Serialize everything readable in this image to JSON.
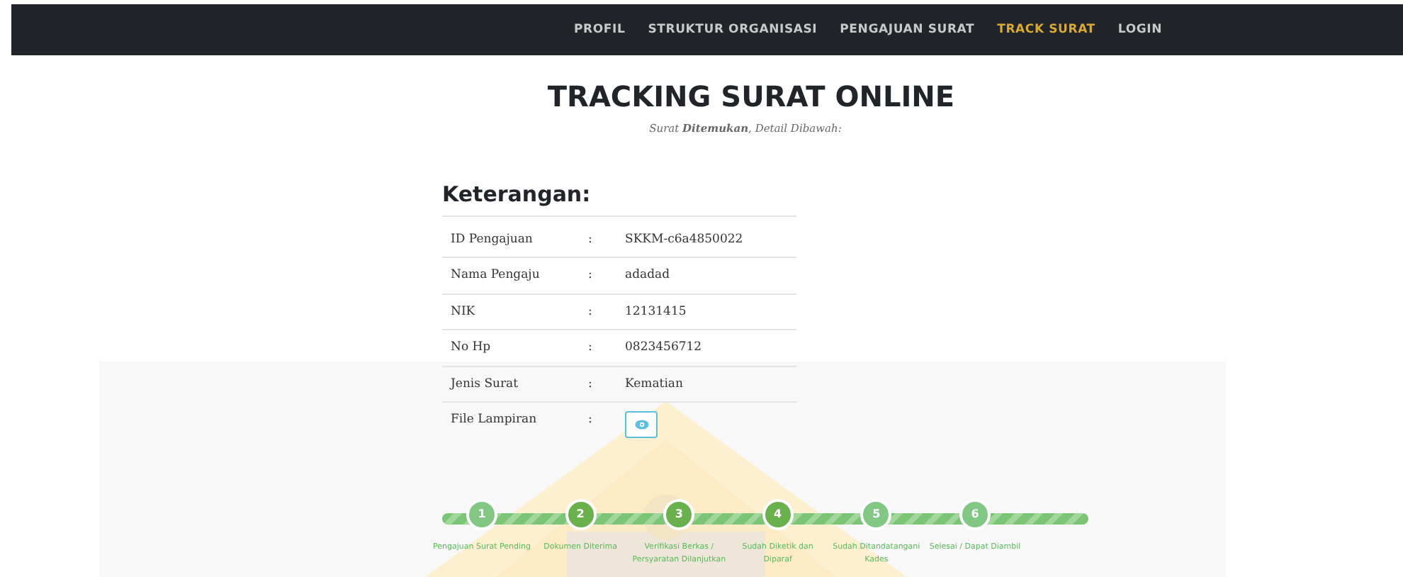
{
  "navbar": {
    "items": [
      {
        "label": "PROFIL",
        "selected": false
      },
      {
        "label": "STRUKTUR ORGANISASI",
        "selected": false
      },
      {
        "label": "PENGAJUAN SURAT",
        "selected": false
      },
      {
        "label": "TRACK SURAT",
        "selected": true
      },
      {
        "label": "LOGIN",
        "selected": false
      }
    ]
  },
  "header": {
    "title": "TRACKING SURAT ONLINE",
    "subtitle": "Surat **Ditemukan**, Detail Dibawah:"
  },
  "details": {
    "heading": "Keterangan:",
    "rows": [
      {
        "label": "ID Pengajuan",
        "separator": ":",
        "value": "SKKM-c6a4850022"
      },
      {
        "label": "Nama Pengaju",
        "separator": ":",
        "value": "adadad"
      },
      {
        "label": "NIK",
        "separator": ":",
        "value": "12131415"
      },
      {
        "label": "No Hp",
        "separator": ":",
        "value": "0823456712"
      },
      {
        "label": "Jenis Surat",
        "separator": ":",
        "value": "Kematian"
      },
      {
        "label": "File Lampiran",
        "separator": ":",
        "kind": "button"
      }
    ]
  },
  "steps": [
    {
      "number": "1",
      "label": "Pengajuan Surat Pending",
      "active": false
    },
    {
      "number": "2",
      "label": "Dokumen Diterima",
      "active": true
    },
    {
      "number": "3",
      "label": "Verifikasi Berkas / Persyaratan Dilanjutkan",
      "active": true
    },
    {
      "number": "4",
      "label": "Sudah Diketik dan Diparaf",
      "active": true
    },
    {
      "number": "5",
      "label": "Sudah Ditandatangani Kades",
      "active": false
    },
    {
      "number": "6",
      "label": "Selesai / Dapat Diambil",
      "active": false
    }
  ]
}
